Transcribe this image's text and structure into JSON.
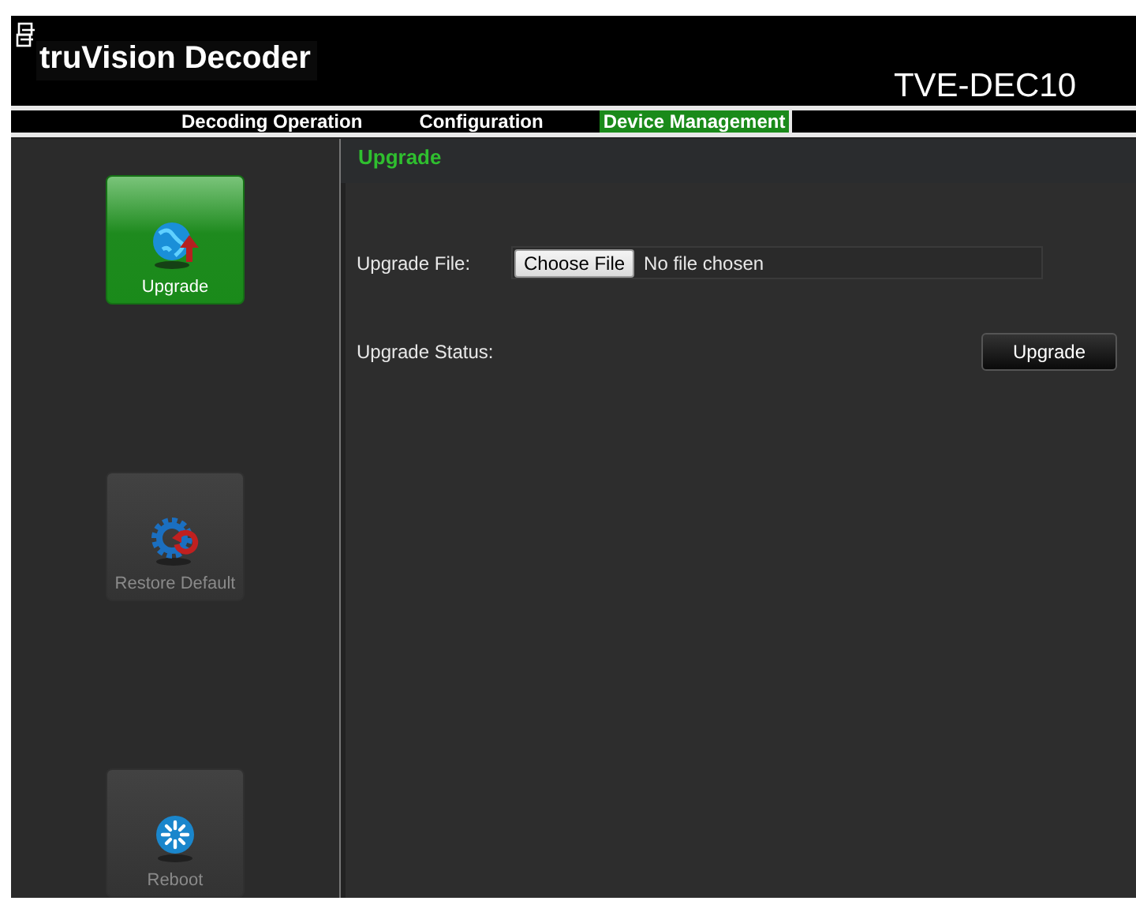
{
  "header": {
    "title": "truVision Decoder",
    "model": "TVE-DEC10"
  },
  "tabs": [
    {
      "label": "Decoding Operation",
      "selected": false
    },
    {
      "label": "Configuration",
      "selected": false
    },
    {
      "label": "Device Management",
      "selected": true
    }
  ],
  "sidebar": {
    "items": [
      {
        "label": "Upgrade",
        "kind": "upgrade",
        "selected": true
      },
      {
        "label": "Restore Default",
        "kind": "restore",
        "selected": false
      },
      {
        "label": "Reboot",
        "kind": "reboot",
        "selected": false
      }
    ]
  },
  "panel": {
    "title": "Upgrade",
    "file_label": "Upgrade File:",
    "choose_button": "Choose File",
    "file_value": "No file chosen",
    "status_label": "Upgrade Status:",
    "upgrade_button": "Upgrade"
  }
}
